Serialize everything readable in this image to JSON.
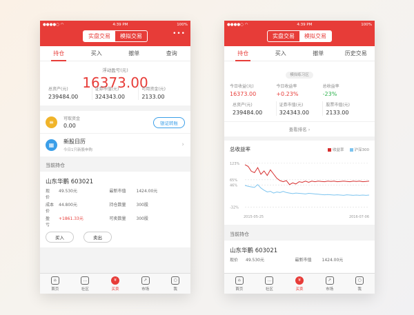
{
  "status": {
    "time": "4:39 PM",
    "battery": "100%"
  },
  "segments": [
    "实盘交易",
    "模拟交易"
  ],
  "more": "•••",
  "nav": [
    {
      "label": "首页",
      "icon": "home-icon",
      "glyph": "⌂"
    },
    {
      "label": "社区",
      "icon": "chat-icon",
      "glyph": "…"
    },
    {
      "label": "买卖",
      "icon": "yuan-icon",
      "glyph": "¥"
    },
    {
      "label": "市场",
      "icon": "trend-icon",
      "glyph": "↗"
    },
    {
      "label": "我",
      "icon": "user-icon",
      "glyph": "○"
    }
  ],
  "p1": {
    "tabs": [
      "持仓",
      "买入",
      "撤单",
      "查询"
    ],
    "pl_label": "浮动盈亏(元)",
    "pl_value": "16373.00",
    "stats": [
      {
        "l": "总资产(元)",
        "v": "239484.00"
      },
      {
        "l": "证券市值(元)",
        "v": "324343.00"
      },
      {
        "l": "可用资金(元)",
        "v": "2133.00"
      }
    ],
    "fund_label": "可取资金",
    "fund_value": "0.00",
    "fund_btn": "银证转账",
    "ipo_title": "新股日历",
    "ipo_sub": "今日1只新股申购",
    "section": "当前持仓",
    "stock": "山东华鹏 603021",
    "h": [
      [
        "现　价",
        "49.530元",
        "最新市值",
        "1424.00元"
      ],
      [
        "成本价",
        "44.800元",
        "持仓数量",
        "300股"
      ],
      [
        "盈　亏",
        "+1861.33元",
        "可卖数量",
        "300股"
      ]
    ],
    "buy": "买入",
    "sell": "卖出"
  },
  "p2": {
    "tabs": [
      "持仓",
      "买入",
      "撤单",
      "历史交易"
    ],
    "badge": "模拟练习区",
    "m": [
      {
        "l": "今日收益(元)",
        "v": "16373.00",
        "c": "red"
      },
      {
        "l": "今日收益率",
        "v": "+0.23%",
        "c": "red"
      },
      {
        "l": "总收益率",
        "v": "-23%",
        "c": "grn"
      }
    ],
    "stats": [
      {
        "l": "总资产(元)",
        "v": "239484.00"
      },
      {
        "l": "证券市值(元)",
        "v": "324343.00"
      },
      {
        "l": "股票市值(元)",
        "v": "2133.00"
      }
    ],
    "rank": "查看排名 ›",
    "chart_title": "总收益率",
    "section": "当前持仓",
    "stock": "山东华鹏 603021",
    "h": [
      [
        "现价",
        "49.530元",
        "最新市值",
        "1424.00元"
      ]
    ]
  },
  "chart_data": {
    "type": "line",
    "legend": [
      {
        "name": "收益率",
        "color": "#d62d2d"
      },
      {
        "name": "沪深300",
        "color": "#7cc4ef"
      }
    ],
    "ytick_labels": [
      "123%",
      "65%",
      "46%",
      "-32%"
    ],
    "ytick_values": [
      123,
      65,
      46,
      -32
    ],
    "ylim": [
      -40,
      130
    ],
    "x_labels": [
      "2015-05-25",
      "2016-07-06"
    ],
    "series": [
      {
        "name": "收益率",
        "color": "#d62d2d",
        "values": [
          118,
          112,
          95,
          90,
          108,
          84,
          96,
          80,
          100,
          85,
          70,
          62,
          58,
          62,
          48,
          54,
          50,
          58,
          56,
          60,
          56,
          60,
          58,
          60,
          59,
          58,
          60,
          59,
          60,
          58,
          59,
          60,
          59,
          58,
          60,
          59,
          60,
          58,
          59,
          60
        ]
      },
      {
        "name": "沪深300",
        "color": "#7cc4ef",
        "values": [
          45,
          42,
          40,
          38,
          48,
          36,
          28,
          22,
          24,
          18,
          22,
          20,
          24,
          20,
          18,
          16,
          18,
          17,
          16,
          15,
          17,
          16,
          15,
          14,
          13,
          12,
          13,
          12,
          11,
          12,
          11,
          10,
          12,
          11,
          10,
          11,
          10,
          11,
          10,
          11
        ]
      }
    ]
  },
  "colors": {
    "accent": "#e73c38",
    "blue": "#3a9ee8",
    "green": "#2bb14b"
  }
}
